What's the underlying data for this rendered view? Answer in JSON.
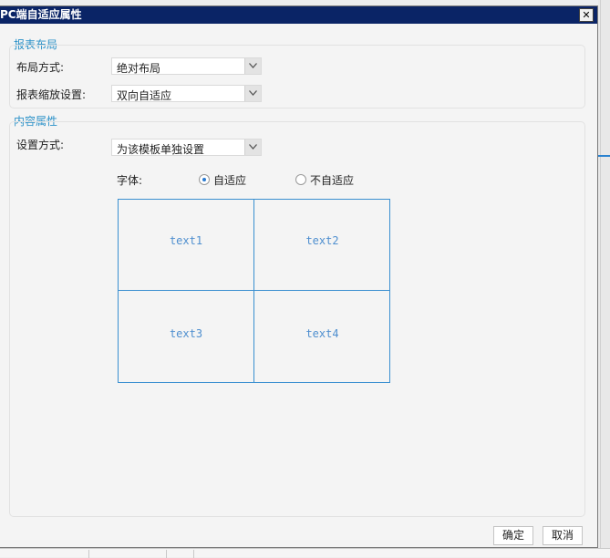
{
  "dialog": {
    "title": "PC端自适应属性",
    "close_label": "✕"
  },
  "report_layout": {
    "section_title": "报表布局",
    "layout_mode": {
      "label": "布局方式:",
      "value": "绝对布局"
    },
    "zoom_setting": {
      "label": "报表缩放设置:",
      "value": "双向自适应"
    }
  },
  "content_properties": {
    "section_title": "内容属性",
    "setting_mode": {
      "label": "设置方式:",
      "value": "为该模板单独设置"
    },
    "font": {
      "label": "字体:",
      "options": [
        {
          "label": "自适应",
          "selected": true
        },
        {
          "label": "不自适应",
          "selected": false
        }
      ]
    },
    "preview_cells": [
      "text1",
      "text2",
      "text3",
      "text4"
    ]
  },
  "footer": {
    "ok_label": "确定",
    "cancel_label": "取消"
  },
  "colors": {
    "title_bar": "#0a2466",
    "section_title": "#2a91c8",
    "preview_border": "#3a8fd0",
    "preview_text": "#4f8fcf"
  }
}
